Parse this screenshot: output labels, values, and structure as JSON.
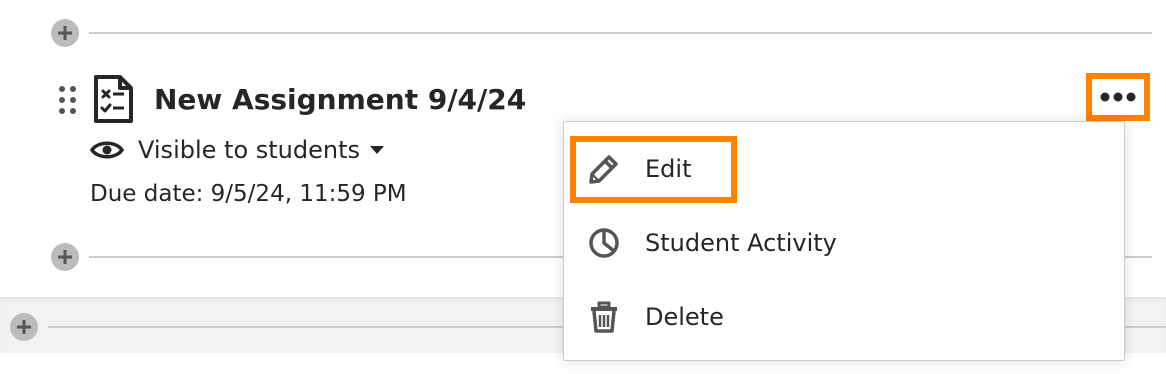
{
  "item": {
    "title": "New Assignment 9/4/24",
    "visibility_label": "Visible to students",
    "due_date": "Due date: 9/5/24, 11:59 PM"
  },
  "icons": {
    "drag_handle": "drag-handle-icon",
    "assignment": "assignment-document-icon",
    "visibility": "eye-icon",
    "dropdown": "caret-down-icon",
    "more": "more-options-icon",
    "add": "plus-icon",
    "edit": "pencil-icon",
    "activity": "pie-chart-icon",
    "delete": "trash-icon"
  },
  "menu": {
    "items": [
      {
        "label": "Edit"
      },
      {
        "label": "Student Activity"
      },
      {
        "label": "Delete"
      }
    ]
  },
  "colors": {
    "highlight": "#ff8200",
    "text": "#262626",
    "divider": "#cdcdcd",
    "add_button": "#bcbcbc",
    "menu_border": "#c9c9c9",
    "lower_background": "#f2f2f2"
  }
}
